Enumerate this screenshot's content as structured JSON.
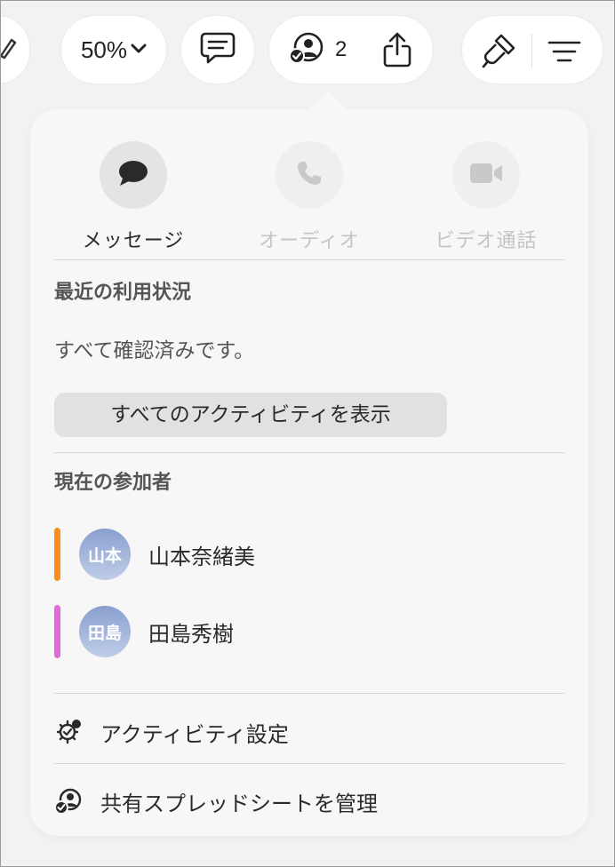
{
  "toolbar": {
    "zoom_label": "50%",
    "collaborator_count": "2"
  },
  "popover": {
    "communication": [
      {
        "label": "メッセージ",
        "enabled": true
      },
      {
        "label": "オーディオ",
        "enabled": false
      },
      {
        "label": "ビデオ通話",
        "enabled": false
      }
    ],
    "recent_activity": {
      "title": "最近の利用状況",
      "status": "すべて確認済みです。",
      "show_all_label": "すべてのアクティビティを表示"
    },
    "participants": {
      "title": "現在の参加者",
      "people": [
        {
          "initials": "山本",
          "name": "山本奈緒美",
          "color": "#ff8c1a"
        },
        {
          "initials": "田島",
          "name": "田島秀樹",
          "color": "#e36ad8"
        }
      ]
    },
    "menu": {
      "activity_settings": "アクティビティ設定",
      "manage_shared": "共有スプレッドシートを管理"
    }
  }
}
